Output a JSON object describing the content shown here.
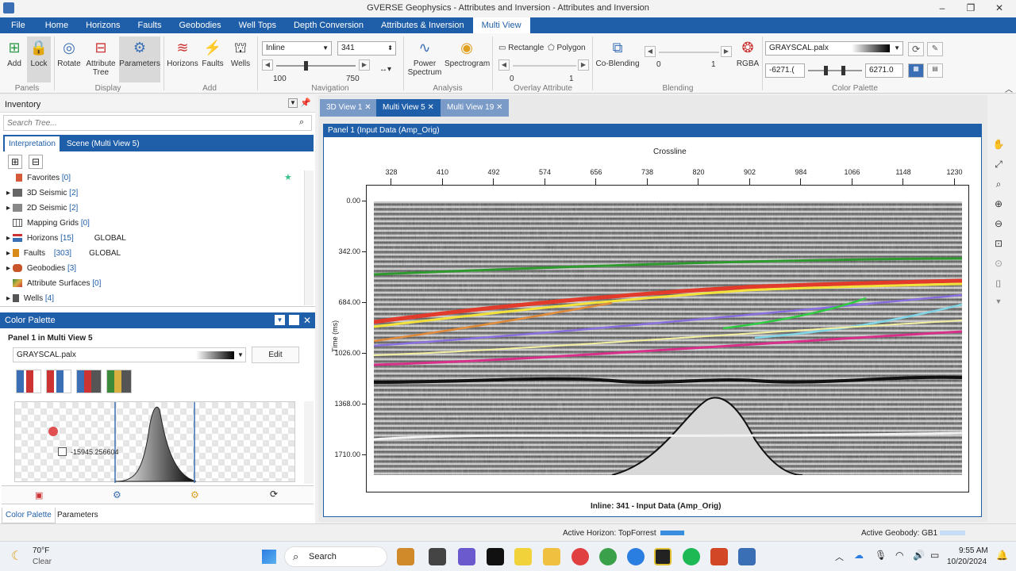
{
  "window": {
    "title": "GVERSE Geophysics - Attributes and Inversion - Attributes and Inversion"
  },
  "menu": [
    "File",
    "Home",
    "Horizons",
    "Faults",
    "Geobodies",
    "Well Tops",
    "Depth Conversion",
    "Attributes & Inversion",
    "Multi View"
  ],
  "menu_active": "Multi View",
  "ribbon": {
    "panels_group": "Panels",
    "add_label": "Add",
    "lock_label": "Lock",
    "display_group": "Display",
    "rotate_label": "Rotate",
    "attribute_tree_label_1": "Attribute",
    "attribute_tree_label_2": "Tree",
    "parameters_label": "Parameters",
    "add_group": "Add",
    "horizons_label": "Horizons",
    "faults_label": "Faults",
    "wells_label": "Wells",
    "navigation_group": "Navigation",
    "nav_direction": "Inline",
    "nav_value": "341",
    "nav_min": "100",
    "nav_max": "750",
    "nav_slider_fraction": 0.37,
    "analysis_group": "Analysis",
    "power_spectrum_1": "Power",
    "power_spectrum_2": "Spectrum",
    "spectrogram_label": "Spectrogram",
    "overlay_group": "Overlay Attribute",
    "rectangle_label": "Rectangle",
    "polygon_label": "Polygon",
    "overlay_min": "0",
    "overlay_max": "1",
    "blending_group": "Blending",
    "coblending_label": "Co-Blending",
    "blend_min": "0",
    "blend_max": "1",
    "rgba_label": "RGBA",
    "palette_group": "Color Palette",
    "palette_name": "GRAYSCAL.palx",
    "palette_min": "-6271.(",
    "palette_max": "6271.0"
  },
  "inventory": {
    "title": "Inventory",
    "search_placeholder": "Search Tree...",
    "tabs": [
      "Interpretation",
      "Scene (Multi View 5)"
    ],
    "items": [
      {
        "label": "Favorites",
        "count": "[0]",
        "extra": ""
      },
      {
        "label": "3D Seismic",
        "count": "[2]",
        "extra": ""
      },
      {
        "label": "2D Seismic",
        "count": "[2]",
        "extra": ""
      },
      {
        "label": "Mapping Grids",
        "count": "[0]",
        "extra": ""
      },
      {
        "label": "Horizons",
        "count": "[15]",
        "extra": "GLOBAL"
      },
      {
        "label": "Faults",
        "count": "[303]",
        "extra": "GLOBAL"
      },
      {
        "label": "Geobodies",
        "count": "[3]",
        "extra": ""
      },
      {
        "label": "Attribute Surfaces",
        "count": "[0]",
        "extra": ""
      },
      {
        "label": "Wells",
        "count": "[4]",
        "extra": ""
      }
    ]
  },
  "color_palette_panel": {
    "title": "Color Palette",
    "panel_label": "Panel 1 in Multi View 5",
    "palette_name": "GRAYSCAL.palx",
    "edit_label": "Edit",
    "value_readout": "-15945.256604",
    "bottom_tabs": [
      "Color Palette",
      "Parameters"
    ]
  },
  "views": {
    "tabs": [
      "3D View 1",
      "Multi View 5",
      "Multi View 19"
    ],
    "active_tab": "Multi View 5",
    "panel_title": "Panel 1 (Input Data (Amp_Orig)",
    "xaxis_title": "Crossline",
    "xticks": [
      "328",
      "410",
      "492",
      "574",
      "656",
      "738",
      "820",
      "902",
      "984",
      "1066",
      "1148",
      "1230"
    ],
    "yaxis_title": "Time (ms)",
    "yticks": [
      "0.00",
      "342.00",
      "684.00",
      "1026.00",
      "1368.00",
      "1710.00"
    ],
    "footer": "Inline: 341 - Input Data (Amp_Orig)"
  },
  "status": {
    "active_horizon": "Active Horizon: TopForrest",
    "active_geobody": "Active Geobody: GB1"
  },
  "taskbar": {
    "weather_temp": "70°F",
    "weather_desc": "Clear",
    "search_label": "Search",
    "time": "9:55 AM",
    "date": "10/20/2024"
  },
  "colors": {
    "accent": "#1f5ea8",
    "horizon_green": "#2e9a2e",
    "horizon_red": "#e23b2b",
    "horizon_yellow": "#f2e23a",
    "horizon_orange": "#e08a3a",
    "horizon_purple": "#8a6fe0",
    "horizon_cyan": "#7fd6e6",
    "horizon_magenta": "#d8308a"
  }
}
